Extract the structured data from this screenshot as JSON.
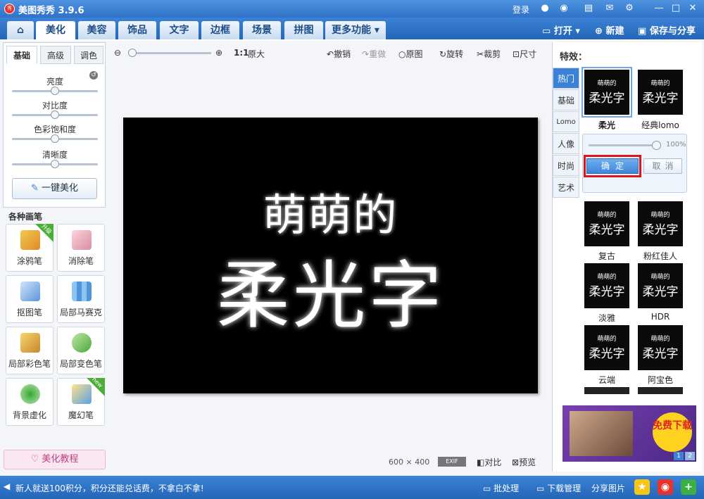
{
  "app": {
    "title": "美图秀秀 3.9.6",
    "logo": "秀",
    "login": "登录"
  },
  "tabs": [
    "美化",
    "美容",
    "饰品",
    "文字",
    "边框",
    "场景",
    "拼图",
    "更多功能"
  ],
  "header_actions": {
    "open": "打开",
    "new": "新建",
    "save_share": "保存与分享"
  },
  "left_tabs": [
    "基础",
    "高级",
    "调色"
  ],
  "sliders": [
    {
      "label": "亮度",
      "value": 0.5
    },
    {
      "label": "对比度",
      "value": 0.5
    },
    {
      "label": "色彩饱和度",
      "value": 0.5
    },
    {
      "label": "清晰度",
      "value": 0.5
    }
  ],
  "onekey_label": "一键美化",
  "brush_title": "各种画笔",
  "brushes": [
    {
      "label": "涂鸦笔",
      "badge": "升级"
    },
    {
      "label": "消除笔",
      "badge": ""
    },
    {
      "label": "抠图笔",
      "badge": ""
    },
    {
      "label": "局部马赛克",
      "badge": ""
    },
    {
      "label": "局部彩色笔",
      "badge": ""
    },
    {
      "label": "局部变色笔",
      "badge": ""
    },
    {
      "label": "背景虚化",
      "badge": ""
    },
    {
      "label": "魔幻笔",
      "badge": "new"
    }
  ],
  "tutorial": "美化教程",
  "canvas_toolbar": {
    "ratio": "1:1",
    "original_size": "原大",
    "undo": "撤销",
    "redo": "重做",
    "original": "原图",
    "rotate": "旋转",
    "crop": "裁剪",
    "size": "尺寸"
  },
  "image": {
    "line1": "萌萌的",
    "line2": "柔光字",
    "width": "600",
    "height": "400",
    "exif": "EXIF",
    "compare": "对比",
    "preview": "预览"
  },
  "effects": {
    "title": "特效：",
    "categories": [
      "热门",
      "基础",
      "Lomo",
      "人像",
      "时尚",
      "艺术"
    ],
    "thumb_line1": "萌萌的",
    "thumb_line2": "柔光字",
    "items": [
      "柔光",
      "经典lomo",
      "复古",
      "粉红佳人",
      "淡雅",
      "HDR",
      "云端",
      "阿宝色"
    ],
    "opacity": "100%",
    "opacity_value": 1.0,
    "ok": "确定",
    "cancel": "取消",
    "ad_badge": "免费下载",
    "pages": [
      "1",
      "2"
    ]
  },
  "status": {
    "text": "新人就送100积分，积分还能兑话费，不拿白不拿!",
    "batch": "批处理",
    "download": "下载管理",
    "share": "分享图片"
  },
  "colors": {
    "accent": "#2f72c8",
    "highlight": "#e0151b",
    "image_bg": "#000000"
  }
}
